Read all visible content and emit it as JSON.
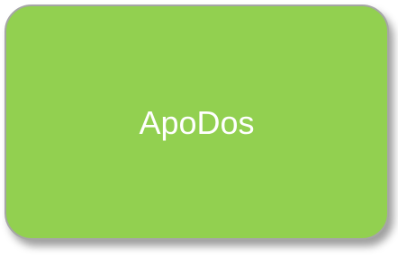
{
  "node": {
    "label": "ApoDos",
    "fill_color": "#92d050",
    "border_color": "#a6a6a6",
    "text_color": "#ffffff"
  }
}
